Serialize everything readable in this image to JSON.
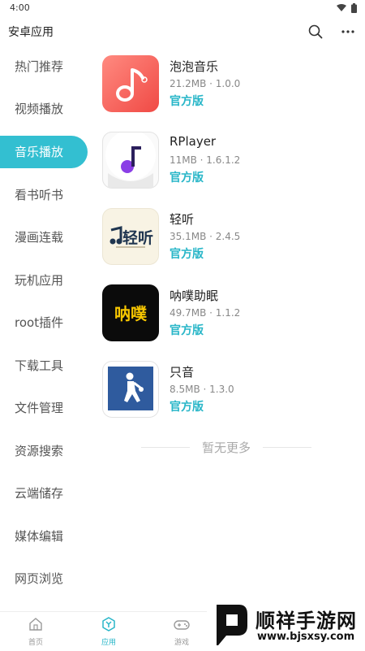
{
  "status": {
    "time": "4:00"
  },
  "app_bar": {
    "title": "安卓应用",
    "search_icon": "search-icon",
    "more_icon": "more-icon"
  },
  "sidebar": {
    "items": [
      {
        "label": "热门推荐"
      },
      {
        "label": "视频播放"
      },
      {
        "label": "音乐播放",
        "active": true
      },
      {
        "label": "看书听书"
      },
      {
        "label": "漫画连载"
      },
      {
        "label": "玩机应用"
      },
      {
        "label": "root插件"
      },
      {
        "label": "下载工具"
      },
      {
        "label": "文件管理"
      },
      {
        "label": "资源搜索"
      },
      {
        "label": "云端储存"
      },
      {
        "label": "媒体编辑"
      },
      {
        "label": "网页浏览"
      }
    ]
  },
  "apps": [
    {
      "name": "泡泡音乐",
      "meta": "21.2MB · 1.0.0",
      "tag": "官方版",
      "icon": "music-note-icon"
    },
    {
      "name": "RPlayer",
      "meta": "11MB · 1.6.1.2",
      "tag": "官方版",
      "icon": "music-note-icon"
    },
    {
      "name": "轻听",
      "meta": "35.1MB · 2.4.5",
      "tag": "官方版",
      "icon": "music-logo-icon",
      "icon_text": "轻听"
    },
    {
      "name": "呐噗助眠",
      "meta": "49.7MB · 1.1.2",
      "tag": "官方版",
      "icon": "text-logo-icon",
      "icon_text": "呐噗"
    },
    {
      "name": "只音",
      "meta": "8.5MB · 1.3.0",
      "tag": "官方版",
      "icon": "basketball-player-icon"
    }
  ],
  "list_footer": "暂无更多",
  "bottom_nav": {
    "items": [
      {
        "label": "首页",
        "icon": "home-icon"
      },
      {
        "label": "应用",
        "icon": "apps-icon",
        "active": true
      },
      {
        "label": "游戏",
        "icon": "gamepad-icon"
      }
    ]
  },
  "watermark": {
    "title": "顺祥手游网",
    "url": "www.bjsxsy.com"
  }
}
